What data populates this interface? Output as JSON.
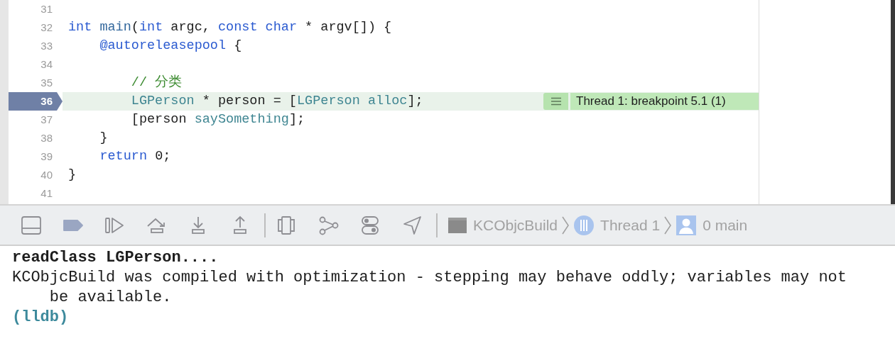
{
  "editor": {
    "lines": [
      {
        "number": "31",
        "current": false
      },
      {
        "number": "32",
        "current": false,
        "tokens": [
          {
            "kind": "keyword",
            "text": "int"
          },
          {
            "kind": "decl",
            "text": " main"
          },
          {
            "kind": "plain",
            "text": "("
          },
          {
            "kind": "keyword",
            "text": "int"
          },
          {
            "kind": "plain",
            "text": " argc, "
          },
          {
            "kind": "keyword",
            "text": "const"
          },
          {
            "kind": "keyword",
            "text": " char"
          },
          {
            "kind": "plain",
            "text": " * argv[]) {"
          }
        ]
      },
      {
        "number": "33",
        "current": false,
        "tokens": [
          {
            "kind": "keyword",
            "text": "    @autoreleasepool"
          },
          {
            "kind": "plain",
            "text": " {"
          }
        ]
      },
      {
        "number": "34",
        "current": false
      },
      {
        "number": "35",
        "current": false,
        "tokens": [
          {
            "kind": "comment",
            "text": "        // 分类"
          }
        ]
      },
      {
        "number": "36",
        "current": true,
        "tokens": [
          {
            "kind": "type",
            "text": "        LGPerson"
          },
          {
            "kind": "plain",
            "text": " * person = ["
          },
          {
            "kind": "type",
            "text": "LGPerson"
          },
          {
            "kind": "method",
            "text": " alloc"
          },
          {
            "kind": "plain",
            "text": "];"
          }
        ],
        "annotation": "Thread 1: breakpoint 5.1 (1)"
      },
      {
        "number": "37",
        "current": false,
        "tokens": [
          {
            "kind": "plain",
            "text": "        [person "
          },
          {
            "kind": "method",
            "text": "saySomething"
          },
          {
            "kind": "plain",
            "text": "];"
          }
        ]
      },
      {
        "number": "38",
        "current": false,
        "tokens": [
          {
            "kind": "plain",
            "text": "    }"
          }
        ]
      },
      {
        "number": "39",
        "current": false,
        "tokens": [
          {
            "kind": "keyword",
            "text": "    return"
          },
          {
            "kind": "plain",
            "text": " 0;"
          }
        ]
      },
      {
        "number": "40",
        "current": false,
        "tokens": [
          {
            "kind": "plain",
            "text": "}"
          }
        ]
      },
      {
        "number": "41",
        "current": false
      }
    ]
  },
  "debug_bar": {
    "breakpoints_active": true,
    "breadcrumb": [
      {
        "kind": "app",
        "label": "KCObjcBuild"
      },
      {
        "kind": "thread",
        "label": "Thread 1"
      },
      {
        "kind": "frame",
        "label": "0 main"
      }
    ]
  },
  "console": {
    "lines": [
      {
        "kind": "bold",
        "text": "readClass LGPerson...."
      },
      {
        "kind": "plain",
        "text": "KCObjcBuild was compiled with optimization - stepping may behave oddly; variables may not be available."
      },
      {
        "kind": "prompt",
        "text": "(lldb)"
      }
    ]
  }
}
